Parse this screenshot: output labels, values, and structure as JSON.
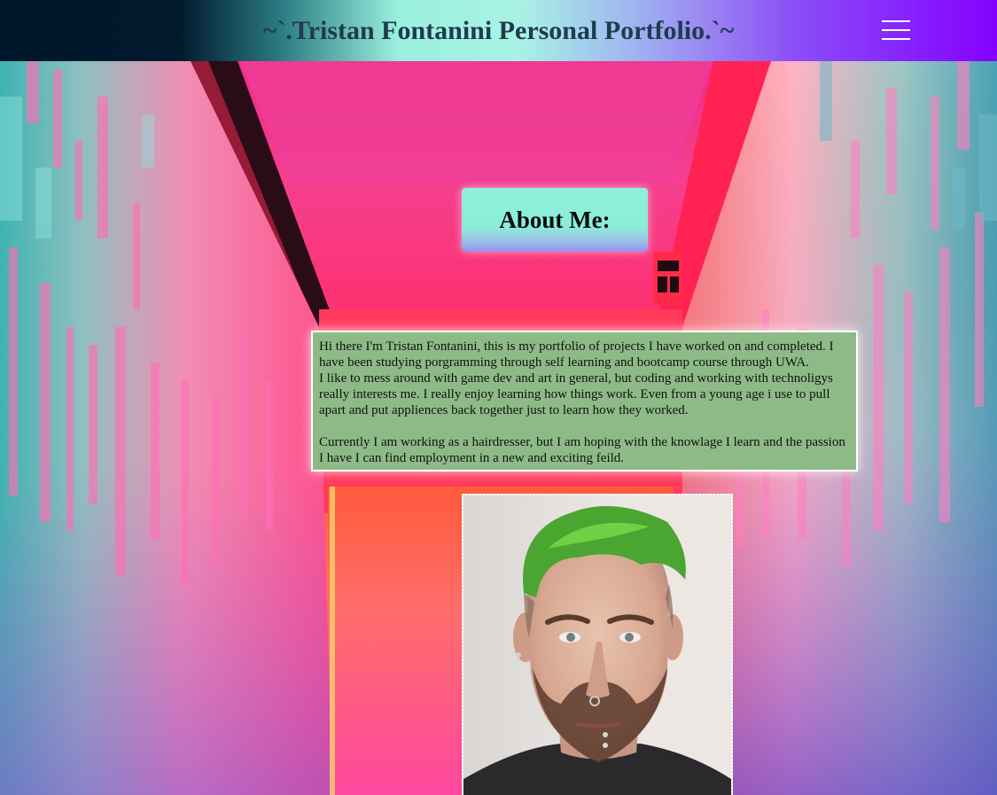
{
  "header": {
    "title": "~`.Tristan Fontanini Personal Portfolio.`~",
    "menu_icon": "hamburger-menu-icon"
  },
  "about": {
    "heading": "About Me:",
    "paragraph_1": "Hi there I'm Tristan Fontanini, this is my portfolio of projects I have worked on and completed. I have been studying porgramming through self learning and bootcamp course through UWA.",
    "paragraph_2": "I like to mess around with game dev and art in general, but coding and working with technoligys really interests me. I really enjoy learning how things work. Even from a young age i use to pull apart and put appliences back together just to learn how they worked.",
    "paragraph_3": "Currently I am working as a hairdresser, but I am hoping with the knowlage I learn and the passion I have I can find employment in a new and exciting feild."
  },
  "colors": {
    "header_gradient_start": "#00162b",
    "header_gradient_mid": "#a9f2e4",
    "header_gradient_end": "#8400ff",
    "title_text": "#1f3b4e",
    "about_heading_bg": "#8ff0dc",
    "bio_bg": "#8dbb88"
  }
}
